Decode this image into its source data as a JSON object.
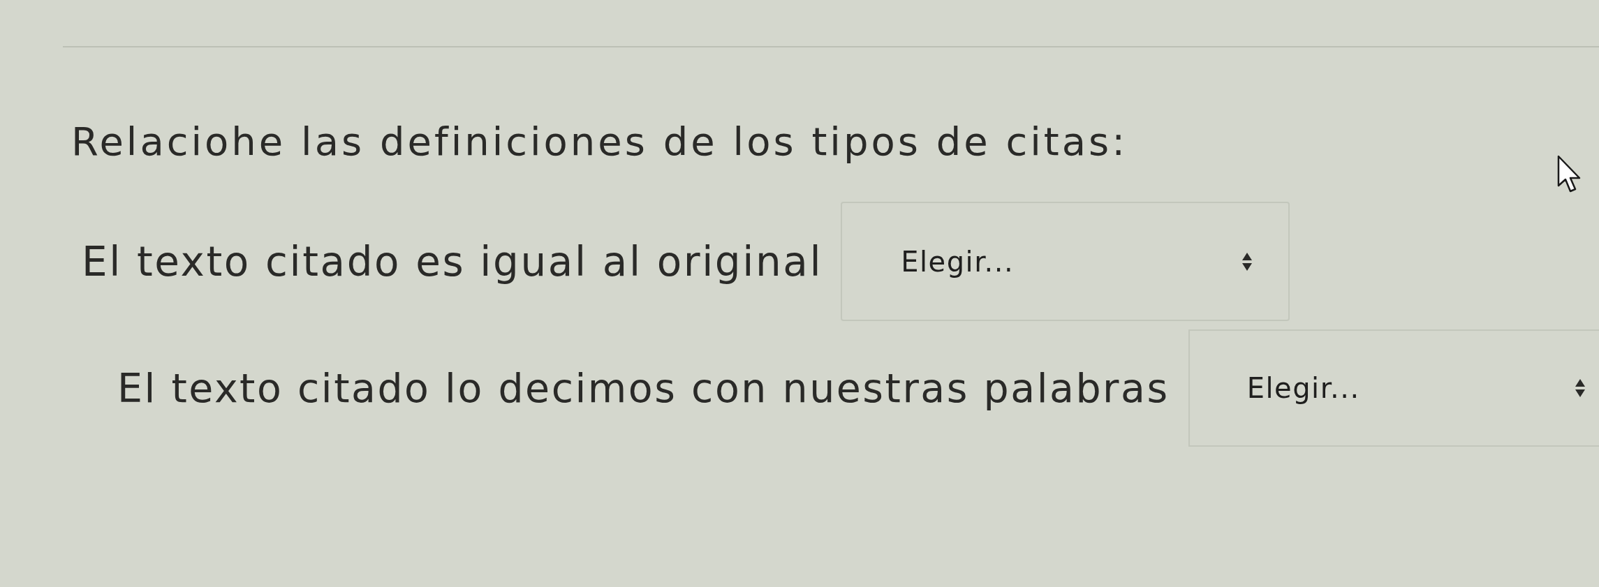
{
  "question": {
    "text": "Relaciohe las definiciones de los tipos de citas:"
  },
  "matches": [
    {
      "definition": "El texto citado es igual al original",
      "choice": {
        "selected_option": "Elegir..."
      }
    },
    {
      "definition": "El texto citado lo decimos con nuestras palabras",
      "choice": {
        "selected_option": "Elegir..."
      }
    }
  ]
}
